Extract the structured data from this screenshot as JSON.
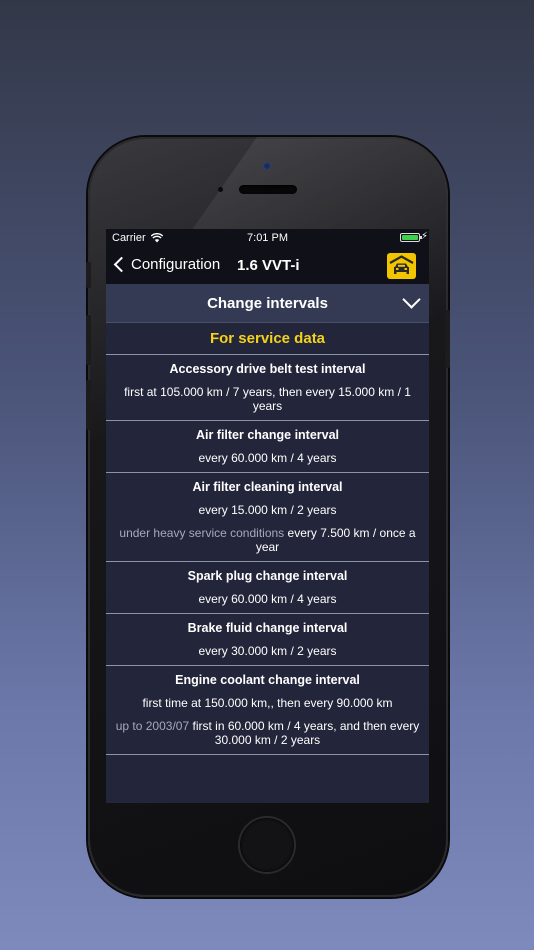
{
  "status_bar": {
    "carrier": "Carrier",
    "time": "7:01 PM"
  },
  "nav": {
    "back_label": "Configuration",
    "title": "1.6 VVT-i",
    "action_icon": "car-garage-icon"
  },
  "section": {
    "title": "Change intervals",
    "subtitle": "For service data"
  },
  "intervals": [
    {
      "title": "Accessory drive belt test interval",
      "lines": [
        {
          "note": "",
          "text": "first at 105.000 km / 7 years, then every 15.000 km / 1 years"
        }
      ]
    },
    {
      "title": "Air filter change interval",
      "lines": [
        {
          "note": "",
          "text": "every 60.000 km / 4 years"
        }
      ]
    },
    {
      "title": "Air filter cleaning interval",
      "lines": [
        {
          "note": "",
          "text": "every 15.000 km / 2 years"
        },
        {
          "note": "under heavy service conditions",
          "text": "every 7.500 km / once a year"
        }
      ]
    },
    {
      "title": "Spark plug change interval",
      "lines": [
        {
          "note": "",
          "text": "every 60.000 km / 4 years"
        }
      ]
    },
    {
      "title": "Brake fluid change interval",
      "lines": [
        {
          "note": "",
          "text": "every 30.000 km / 2 years"
        }
      ]
    },
    {
      "title": "Engine coolant change interval",
      "lines": [
        {
          "note": "",
          "text": "first time at 150.000 km,, then every 90.000 km"
        },
        {
          "note": "up to 2003/07",
          "text": "first in 60.000 km / 4 years, and then every 30.000 km / 2 years"
        }
      ]
    }
  ],
  "colors": {
    "accent_yellow": "#f2d21c",
    "car_button": "#f2c500",
    "list_bg": "#23263a",
    "header_bg": "#353a54"
  }
}
